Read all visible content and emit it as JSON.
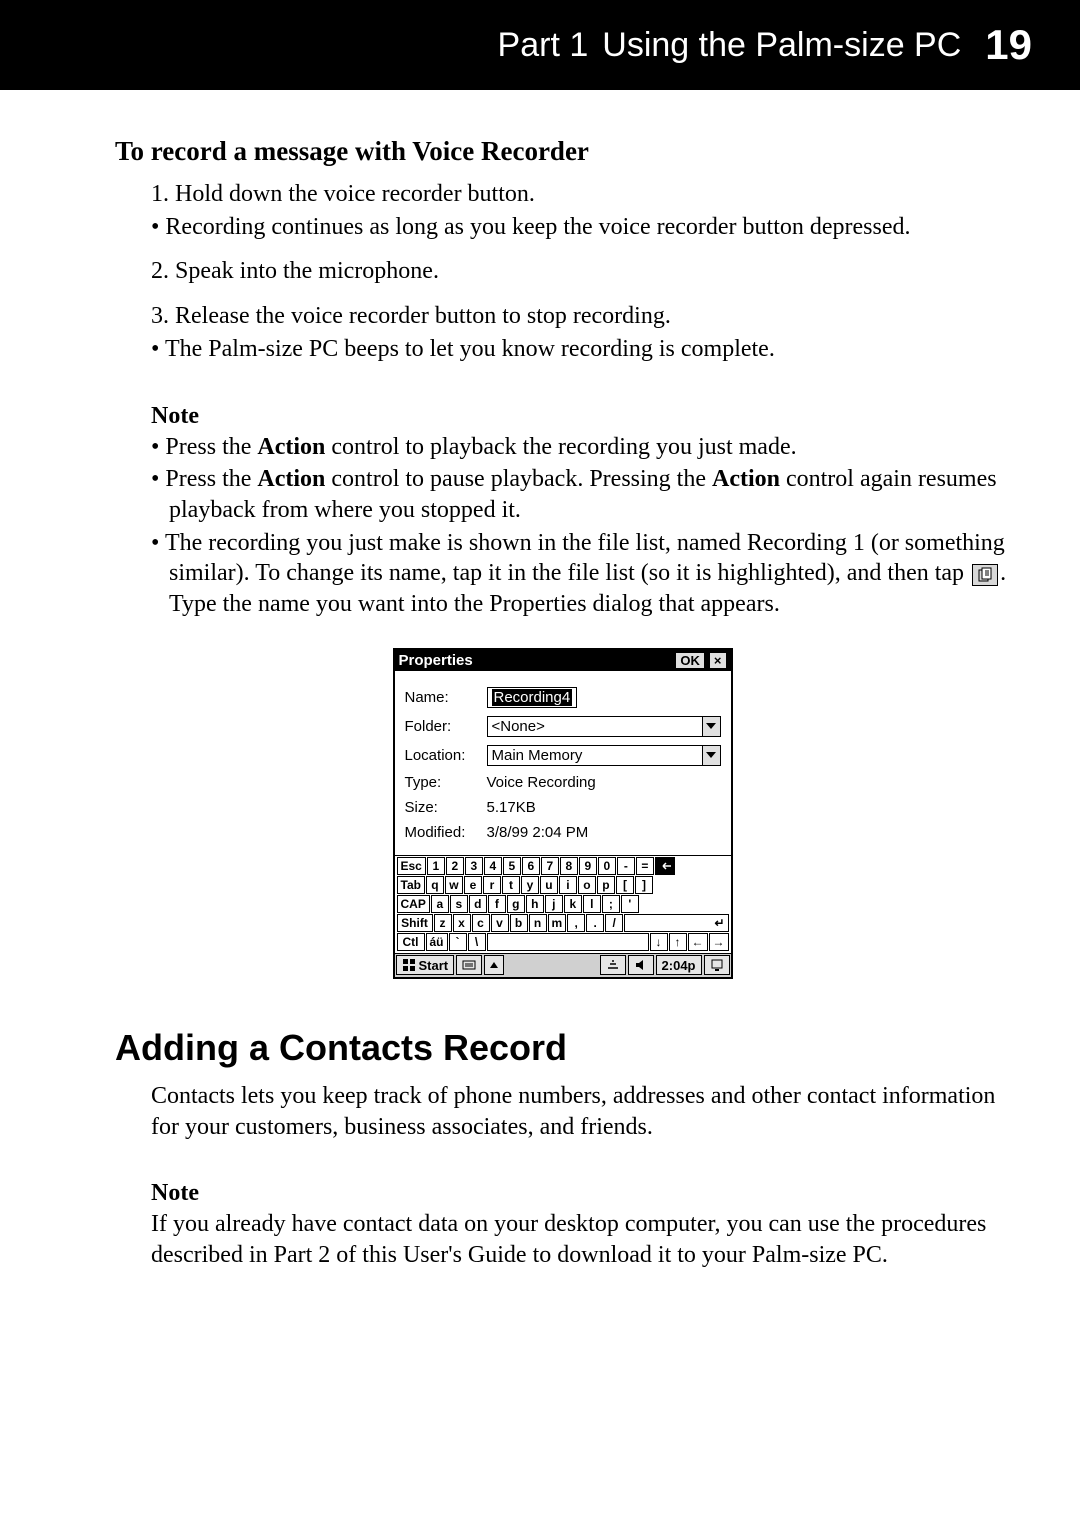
{
  "header": {
    "part": "Part 1",
    "title": "Using the Palm-size PC",
    "page": "19"
  },
  "voice_recorder": {
    "heading": "To record a message with Voice Recorder",
    "step1_prefix": "1. ",
    "step1": "Hold down the voice recorder button.",
    "bullet1_prefix": "• ",
    "bullet1": "Recording continues as long as you keep the voice recorder button depressed.",
    "step2_prefix": "2. ",
    "step2": "Speak into the microphone.",
    "step3_prefix": "3. ",
    "step3": "Release the voice recorder button to stop recording.",
    "bullet2_prefix": "• ",
    "bullet2": "The Palm-size PC beeps to let you know recording is complete.",
    "note_label": "Note",
    "note_b1_prefix": "• ",
    "note_b1_a": "Press the ",
    "note_b1_bold": "Action",
    "note_b1_b": " control to playback the recording you just made.",
    "note_b2_prefix": "• ",
    "note_b2_a": "Press the ",
    "note_b2_bold1": "Action",
    "note_b2_b": " control to pause playback. Pressing the ",
    "note_b2_bold2": "Action",
    "note_b2_c": " control again resumes playback from where you stopped it.",
    "note_b3_prefix": "• ",
    "note_b3_a": "The recording you just make is shown in the file list, named Recording 1 (or something similar). To change its name, tap it in the file list (so it is highlighted), and then tap ",
    "note_b3_b": ". Type the name you want into the Properties dialog that appears."
  },
  "dialog": {
    "title": "Properties",
    "ok": "OK",
    "close": "×",
    "labels": {
      "name": "Name:",
      "folder": "Folder:",
      "location": "Location:",
      "type": "Type:",
      "size": "Size:",
      "modified": "Modified:"
    },
    "values": {
      "name": "Recording4",
      "folder": "<None>",
      "location": "Main Memory",
      "type": "Voice Recording",
      "size": "5.17KB",
      "modified": "3/8/99 2:04 PM"
    },
    "keyboard": {
      "row1": [
        "Esc",
        "1",
        "2",
        "3",
        "4",
        "5",
        "6",
        "7",
        "8",
        "9",
        "0",
        "-",
        "="
      ],
      "row2": [
        "Tab",
        "q",
        "w",
        "e",
        "r",
        "t",
        "y",
        "u",
        "i",
        "o",
        "p",
        "[",
        "]"
      ],
      "row3": [
        "CAP",
        "a",
        "s",
        "d",
        "f",
        "g",
        "h",
        "j",
        "k",
        "l",
        ";",
        "'"
      ],
      "row4": [
        "Shift",
        "z",
        "x",
        "c",
        "v",
        "b",
        "n",
        "m",
        ",",
        ".",
        "/"
      ],
      "row5": [
        "Ctl",
        "áü",
        "`",
        "\\"
      ],
      "arrows": [
        "↓",
        "↑",
        "←",
        "→"
      ]
    },
    "taskbar": {
      "start": "Start",
      "time": "2:04p"
    }
  },
  "contacts": {
    "heading": "Adding a Contacts Record",
    "intro": "Contacts lets you keep track of phone numbers, addresses and other contact information for your customers, business associates, and friends.",
    "note_label": "Note",
    "note_text": "If you already have contact data on your desktop computer, you can use the procedures described in Part 2 of this User's Guide to download it to your Palm-size PC."
  }
}
